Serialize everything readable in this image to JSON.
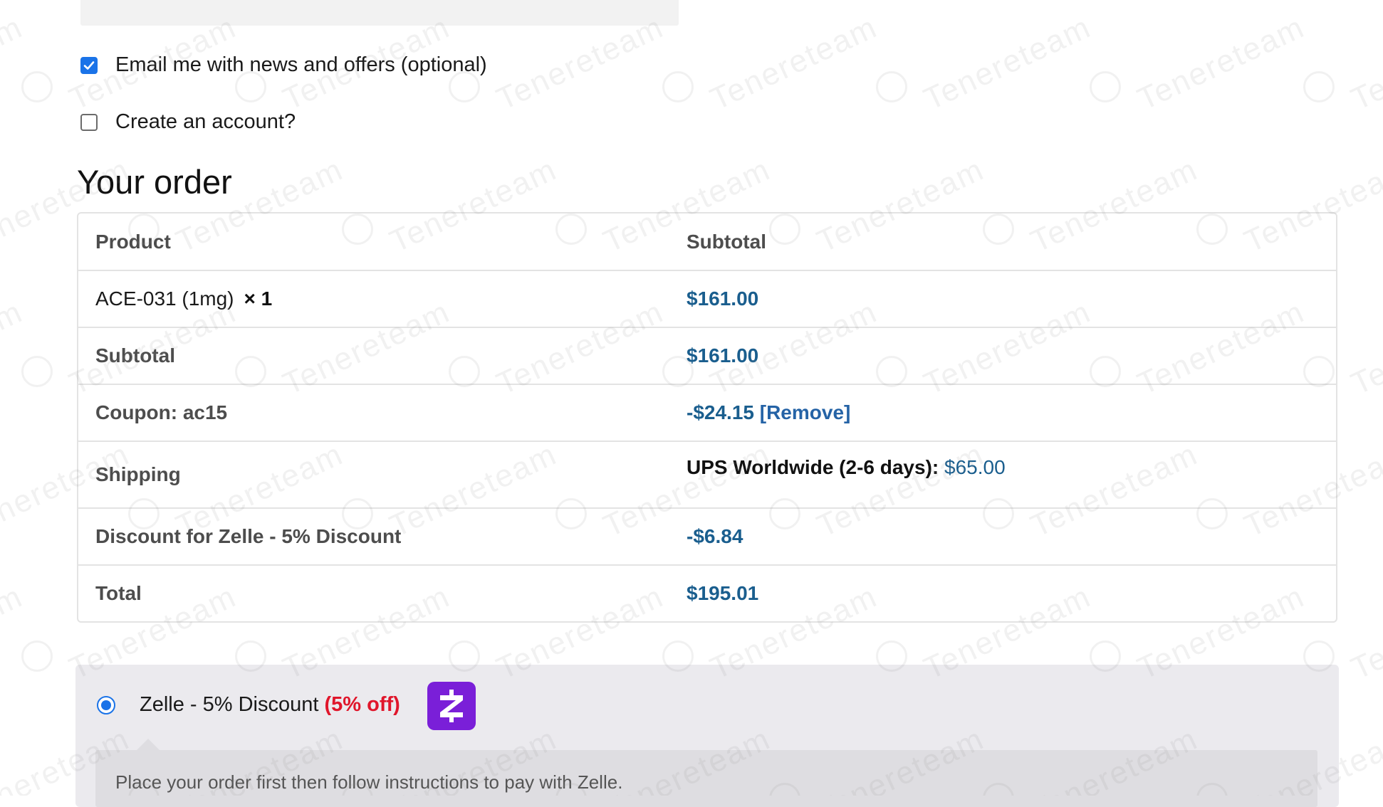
{
  "form": {
    "newsletter": {
      "label": "Email me with news and offers (optional)",
      "checked": true
    },
    "create_account": {
      "label": "Create an account?",
      "checked": false
    }
  },
  "order": {
    "title": "Your order",
    "headers": {
      "product": "Product",
      "subtotal": "Subtotal"
    },
    "item": {
      "name": "ACE-031 (1mg)",
      "qty": "× 1",
      "price": "$161.00"
    },
    "subtotal": {
      "label": "Subtotal",
      "value": "$161.00"
    },
    "coupon": {
      "label": "Coupon: ac15",
      "value": "-$24.15",
      "remove": "[Remove]"
    },
    "shipping": {
      "label": "Shipping",
      "method": "UPS Worldwide (2-6 days):",
      "value": "$65.00"
    },
    "discount": {
      "label": "Discount for Zelle - 5% Discount",
      "value": "-$6.84"
    },
    "total": {
      "label": "Total",
      "value": "$195.01"
    }
  },
  "payment": {
    "method_label": "Zelle - 5% Discount",
    "badge": "(5% off)",
    "instructions": "Place your order first then follow instructions to pay with Zelle.",
    "selected": true
  },
  "watermark": {
    "text": "Tenereteam"
  },
  "colors": {
    "accent": "#1a73e8",
    "price": "#1a5e8e",
    "link": "#2563a6",
    "discount_badge": "#e0162b",
    "zelle_brand": "#7a1fd8"
  }
}
